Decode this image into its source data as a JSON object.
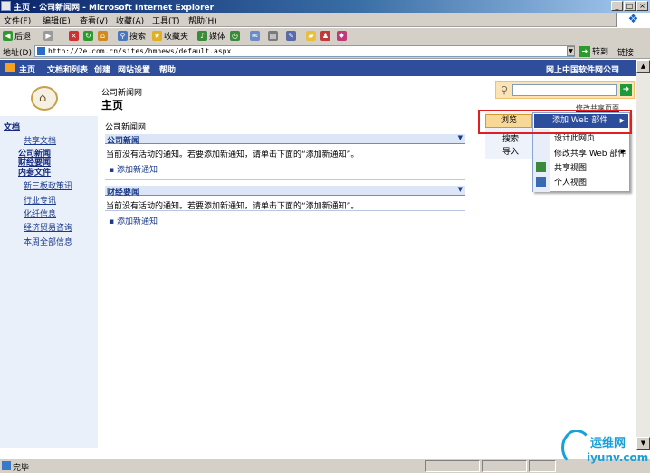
{
  "window": {
    "title": "主页 - 公司新闻网 - Microsoft Internet Explorer"
  },
  "menubar": {
    "items": [
      "文件(F)",
      "编辑(E)",
      "查看(V)",
      "收藏(A)",
      "工具(T)",
      "帮助(H)"
    ]
  },
  "toolbar": {
    "back": "后退",
    "search": "搜索",
    "favorites": "收藏夹",
    "media": "媒体"
  },
  "addressbar": {
    "label": "地址(D)",
    "url": "http://2e.com.cn/sites/hmnews/default.aspx",
    "go": "转到",
    "links": "链接"
  },
  "spnav": {
    "items": [
      "主页",
      "文档和列表",
      "创建",
      "网站设置",
      "帮助"
    ],
    "right": "网上中国软件网公司"
  },
  "page": {
    "breadcrumb": "公司新闻网",
    "title": "主页",
    "modify_link": "修改共享页面"
  },
  "leftnav": {
    "docs_heading": "文档",
    "shared_docs": "共享文档",
    "links": [
      "公司新闻",
      "财经要闻",
      "内参文件"
    ],
    "subitems": [
      "新三板政策讯",
      "行业专讯",
      "化纤信息",
      "经济贸易咨询",
      "本周全部信息"
    ]
  },
  "main": {
    "zone_caption": "公司新闻网",
    "webparts": [
      {
        "title": "公司新闻",
        "empty_text": "当前没有活动的通知。若要添加新通知，请单击下面的“添加新通知”。",
        "add_link": "添加新通知"
      },
      {
        "title": "财经要闻",
        "empty_text": "当前没有活动的通知。若要添加新通知，请单击下面的“添加新通知”。",
        "add_link": "添加新通知"
      }
    ]
  },
  "sidemenu": {
    "view_button": "浏览",
    "left_items": [
      "搜索",
      "导入"
    ],
    "menu": {
      "highlighted": "添加 Web 部件",
      "items": [
        "设计此网页",
        "修改共享 Web 部件",
        "共享视图",
        "个人视图"
      ]
    }
  },
  "statusbar": {
    "text": "完毕"
  },
  "brand": {
    "cn": "运维网",
    "en": "iyunv.com"
  }
}
